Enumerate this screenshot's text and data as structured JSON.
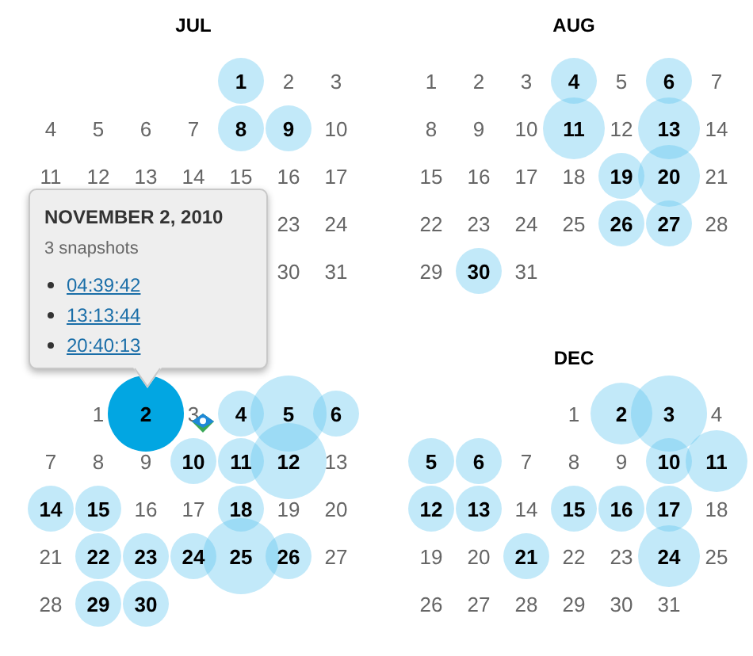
{
  "months": [
    {
      "title": "JUL",
      "weeks": [
        {
          "align_end": true,
          "days": [
            {
              "day": "1",
              "kind": "small",
              "selected": false
            },
            {
              "day": "2",
              "kind": "plain",
              "selected": false
            },
            {
              "day": "3",
              "kind": "plain",
              "selected": false
            }
          ]
        },
        {
          "align_end": false,
          "days": [
            {
              "day": "4",
              "kind": "plain",
              "selected": false
            },
            {
              "day": "5",
              "kind": "plain",
              "selected": false
            },
            {
              "day": "6",
              "kind": "plain",
              "selected": false
            },
            {
              "day": "7",
              "kind": "plain",
              "selected": false
            },
            {
              "day": "8",
              "kind": "small",
              "selected": false
            },
            {
              "day": "9",
              "kind": "small",
              "selected": false
            },
            {
              "day": "10",
              "kind": "plain",
              "selected": false
            }
          ]
        },
        {
          "align_end": false,
          "days": [
            {
              "day": "11",
              "kind": "plain",
              "selected": false
            },
            {
              "day": "12",
              "kind": "plain",
              "selected": false
            },
            {
              "day": "13",
              "kind": "plain",
              "selected": false
            },
            {
              "day": "14",
              "kind": "plain",
              "selected": false
            },
            {
              "day": "15",
              "kind": "plain",
              "selected": false
            },
            {
              "day": "16",
              "kind": "plain",
              "selected": false
            },
            {
              "day": "17",
              "kind": "plain",
              "selected": false
            }
          ]
        },
        {
          "align_end": true,
          "days": [
            {
              "day": "23",
              "kind": "plain",
              "selected": false
            },
            {
              "day": "24",
              "kind": "plain",
              "selected": false
            }
          ]
        },
        {
          "align_end": true,
          "days": [
            {
              "day": "30",
              "kind": "plain",
              "selected": false
            },
            {
              "day": "31",
              "kind": "plain",
              "selected": false
            }
          ]
        }
      ]
    },
    {
      "weeks": [
        {
          "align_end": true,
          "days": [
            {
              "day": "1",
              "kind": "plain",
              "selected": false
            },
            {
              "day": "2",
              "kind": "large",
              "selected": true
            },
            {
              "day": "3",
              "kind": "plain",
              "selected": false
            },
            {
              "day": "4",
              "kind": "small",
              "selected": false
            },
            {
              "day": "5",
              "kind": "large",
              "selected": false
            },
            {
              "day": "6",
              "kind": "small",
              "selected": false
            }
          ]
        },
        {
          "align_end": false,
          "days": [
            {
              "day": "7",
              "kind": "plain",
              "selected": false
            },
            {
              "day": "8",
              "kind": "plain",
              "selected": false
            },
            {
              "day": "9",
              "kind": "plain",
              "selected": false
            },
            {
              "day": "10",
              "kind": "small",
              "selected": false
            },
            {
              "day": "11",
              "kind": "small",
              "selected": false
            },
            {
              "day": "12",
              "kind": "large",
              "selected": false
            },
            {
              "day": "13",
              "kind": "plain",
              "selected": false
            }
          ]
        },
        {
          "align_end": false,
          "days": [
            {
              "day": "14",
              "kind": "small",
              "selected": false
            },
            {
              "day": "15",
              "kind": "small",
              "selected": false
            },
            {
              "day": "16",
              "kind": "plain",
              "selected": false
            },
            {
              "day": "17",
              "kind": "plain",
              "selected": false
            },
            {
              "day": "18",
              "kind": "small",
              "selected": false
            },
            {
              "day": "19",
              "kind": "plain",
              "selected": false
            },
            {
              "day": "20",
              "kind": "plain",
              "selected": false
            }
          ]
        },
        {
          "align_end": false,
          "days": [
            {
              "day": "21",
              "kind": "plain",
              "selected": false
            },
            {
              "day": "22",
              "kind": "small",
              "selected": false
            },
            {
              "day": "23",
              "kind": "small",
              "selected": false
            },
            {
              "day": "24",
              "kind": "small",
              "selected": false
            },
            {
              "day": "25",
              "kind": "large",
              "selected": false
            },
            {
              "day": "26",
              "kind": "small",
              "selected": false
            },
            {
              "day": "27",
              "kind": "plain",
              "selected": false
            }
          ]
        },
        {
          "align_end": false,
          "days": [
            {
              "day": "28",
              "kind": "plain",
              "selected": false
            },
            {
              "day": "29",
              "kind": "small",
              "selected": false
            },
            {
              "day": "30",
              "kind": "small",
              "selected": false
            }
          ]
        }
      ]
    },
    {
      "title": "AUG",
      "weeks": [
        {
          "align_end": false,
          "days": [
            {
              "day": "1",
              "kind": "plain",
              "selected": false
            },
            {
              "day": "2",
              "kind": "plain",
              "selected": false
            },
            {
              "day": "3",
              "kind": "plain",
              "selected": false
            },
            {
              "day": "4",
              "kind": "small",
              "selected": false
            },
            {
              "day": "5",
              "kind": "plain",
              "selected": false
            },
            {
              "day": "6",
              "kind": "small",
              "selected": false
            },
            {
              "day": "7",
              "kind": "plain",
              "selected": false
            }
          ]
        },
        {
          "align_end": false,
          "days": [
            {
              "day": "8",
              "kind": "plain",
              "selected": false
            },
            {
              "day": "9",
              "kind": "plain",
              "selected": false
            },
            {
              "day": "10",
              "kind": "plain",
              "selected": false
            },
            {
              "day": "11",
              "kind": "medium",
              "selected": false
            },
            {
              "day": "12",
              "kind": "plain",
              "selected": false
            },
            {
              "day": "13",
              "kind": "medium",
              "selected": false
            },
            {
              "day": "14",
              "kind": "plain",
              "selected": false
            }
          ]
        },
        {
          "align_end": false,
          "days": [
            {
              "day": "15",
              "kind": "plain",
              "selected": false
            },
            {
              "day": "16",
              "kind": "plain",
              "selected": false
            },
            {
              "day": "17",
              "kind": "plain",
              "selected": false
            },
            {
              "day": "18",
              "kind": "plain",
              "selected": false
            },
            {
              "day": "19",
              "kind": "small",
              "selected": false
            },
            {
              "day": "20",
              "kind": "medium",
              "selected": false
            },
            {
              "day": "21",
              "kind": "plain",
              "selected": false
            }
          ]
        },
        {
          "align_end": false,
          "days": [
            {
              "day": "22",
              "kind": "plain",
              "selected": false
            },
            {
              "day": "23",
              "kind": "plain",
              "selected": false
            },
            {
              "day": "24",
              "kind": "plain",
              "selected": false
            },
            {
              "day": "25",
              "kind": "plain",
              "selected": false
            },
            {
              "day": "26",
              "kind": "small",
              "selected": false
            },
            {
              "day": "27",
              "kind": "small",
              "selected": false
            },
            {
              "day": "28",
              "kind": "plain",
              "selected": false
            }
          ]
        },
        {
          "align_end": false,
          "days": [
            {
              "day": "29",
              "kind": "plain",
              "selected": false
            },
            {
              "day": "30",
              "kind": "small",
              "selected": false
            },
            {
              "day": "31",
              "kind": "plain",
              "selected": false
            }
          ]
        }
      ]
    },
    {
      "title": "DEC",
      "weeks": [
        {
          "align_end": true,
          "days": [
            {
              "day": "1",
              "kind": "plain",
              "selected": false
            },
            {
              "day": "2",
              "kind": "medium",
              "selected": false
            },
            {
              "day": "3",
              "kind": "large",
              "selected": false
            },
            {
              "day": "4",
              "kind": "plain",
              "selected": false
            }
          ]
        },
        {
          "align_end": false,
          "days": [
            {
              "day": "5",
              "kind": "small",
              "selected": false
            },
            {
              "day": "6",
              "kind": "small",
              "selected": false
            },
            {
              "day": "7",
              "kind": "plain",
              "selected": false
            },
            {
              "day": "8",
              "kind": "plain",
              "selected": false
            },
            {
              "day": "9",
              "kind": "plain",
              "selected": false
            },
            {
              "day": "10",
              "kind": "small",
              "selected": false
            },
            {
              "day": "11",
              "kind": "medium",
              "selected": false
            }
          ]
        },
        {
          "align_end": false,
          "days": [
            {
              "day": "12",
              "kind": "small",
              "selected": false
            },
            {
              "day": "13",
              "kind": "small",
              "selected": false
            },
            {
              "day": "14",
              "kind": "plain",
              "selected": false
            },
            {
              "day": "15",
              "kind": "small",
              "selected": false
            },
            {
              "day": "16",
              "kind": "small",
              "selected": false
            },
            {
              "day": "17",
              "kind": "small",
              "selected": false
            },
            {
              "day": "18",
              "kind": "plain",
              "selected": false
            }
          ]
        },
        {
          "align_end": false,
          "days": [
            {
              "day": "19",
              "kind": "plain",
              "selected": false
            },
            {
              "day": "20",
              "kind": "plain",
              "selected": false
            },
            {
              "day": "21",
              "kind": "small",
              "selected": false
            },
            {
              "day": "22",
              "kind": "plain",
              "selected": false
            },
            {
              "day": "23",
              "kind": "plain",
              "selected": false
            },
            {
              "day": "24",
              "kind": "medium",
              "selected": false
            },
            {
              "day": "25",
              "kind": "plain",
              "selected": false
            }
          ]
        },
        {
          "align_end": false,
          "days": [
            {
              "day": "26",
              "kind": "plain",
              "selected": false
            },
            {
              "day": "27",
              "kind": "plain",
              "selected": false
            },
            {
              "day": "28",
              "kind": "plain",
              "selected": false
            },
            {
              "day": "29",
              "kind": "plain",
              "selected": false
            },
            {
              "day": "30",
              "kind": "plain",
              "selected": false
            },
            {
              "day": "31",
              "kind": "plain",
              "selected": false
            }
          ]
        }
      ]
    }
  ],
  "tooltip": {
    "title": "NOVEMBER 2, 2010",
    "count": "3 snapshots",
    "times": [
      "04:39:42",
      "13:13:44",
      "20:40:13"
    ]
  }
}
